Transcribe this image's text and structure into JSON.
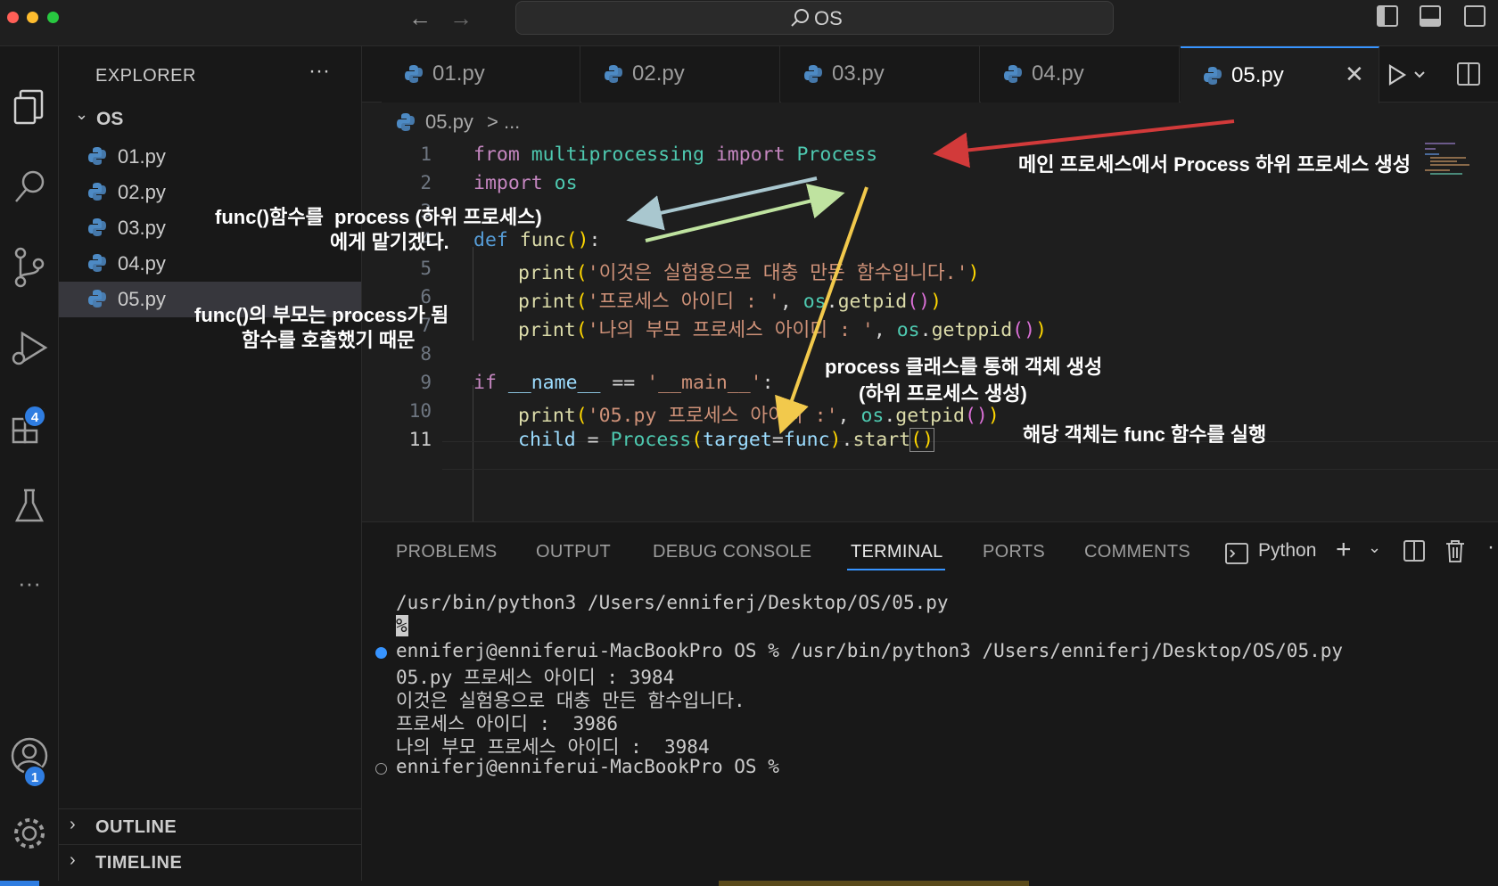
{
  "titlebar": {
    "search_text": "OS"
  },
  "activity": {
    "extensions_badge": "4",
    "accounts_badge": "1"
  },
  "sidebar": {
    "title": "EXPLORER",
    "more": "···",
    "folder": "OS",
    "files": [
      "01.py",
      "02.py",
      "03.py",
      "04.py",
      "05.py"
    ],
    "outline": "OUTLINE",
    "timeline": "TIMELINE"
  },
  "tabs": [
    "01.py",
    "02.py",
    "03.py",
    "04.py",
    "05.py"
  ],
  "breadcrumb": {
    "file": "05.py",
    "rest": "> ..."
  },
  "editor": {
    "line_numbers": [
      "1",
      "2",
      "3",
      "4",
      "5",
      "6",
      "7",
      "8",
      "9",
      "10",
      "11"
    ],
    "l1": {
      "from": "from",
      "module": "multiprocessing",
      "import": "import",
      "cls": "Process"
    },
    "l2": {
      "import": "import",
      "mod": "os"
    },
    "l4": {
      "def": "def",
      "name": "func",
      "open": "(",
      "close": ")",
      "colon": ":"
    },
    "l5": {
      "fn": "print",
      "open": "(",
      "str": "'이것은 실험용으로 대충 만든 함수입니다.'",
      "close": ")"
    },
    "l6": {
      "fn": "print",
      "open": "(",
      "str": "'프로세스 아이디 : '",
      "comma": ", ",
      "obj": "os",
      "dot": ".",
      "call": "getpid",
      "p": "()",
      "close": ")"
    },
    "l7": {
      "fn": "print",
      "open": "(",
      "str": "'나의 부모 프로세스 아이디 : '",
      "comma": ", ",
      "obj": "os",
      "dot": ".",
      "call": "getppid",
      "p": "()",
      "close": ")"
    },
    "l9": {
      "if": "if",
      "name": "__name__",
      "eq": " == ",
      "str": "'__main__'",
      "colon": ":"
    },
    "l10": {
      "fn": "print",
      "open": "(",
      "str": "'05.py 프로세스 아이디 :'",
      "comma": ", ",
      "obj": "os",
      "dot": ".",
      "call": "getpid",
      "p": "()",
      "close": ")"
    },
    "l11": {
      "var": "child",
      "eq": " = ",
      "cls": "Process",
      "open": "(",
      "kw": "target",
      "assign": "=",
      "arg": "func",
      "close": ")",
      "dot": ".",
      "call": "start",
      "p": "()"
    }
  },
  "panel": {
    "tabs": [
      "PROBLEMS",
      "OUTPUT",
      "DEBUG CONSOLE",
      "TERMINAL",
      "PORTS",
      "COMMENTS"
    ],
    "shell": "Python",
    "terminal": [
      "/usr/bin/python3 /Users/enniferj/Desktop/OS/05.py",
      "%",
      "enniferj@enniferui-MacBookPro OS % /usr/bin/python3 /Users/enniferj/Desktop/OS/05.py",
      "05.py 프로세스 아이디 : 3984",
      "이것은 실험용으로 대충 만든 함수입니다.",
      "프로세스 아이디 :  3986",
      "나의 부모 프로세스 아이디 :  3984",
      "enniferj@enniferui-MacBookPro OS %"
    ]
  },
  "annotations": {
    "main_process": "메인 프로세스에서 Process 하위 프로세스 생성",
    "func_delegate_1": "func()함수를  process (하위 프로세스)",
    "func_delegate_2": "에게 맡기겠다.",
    "parent_1": "func()의 부모는 process가 됨",
    "parent_2": "함수를 호출했기 때문",
    "object_1": "process 클래스를 통해 객체 생성",
    "object_2": "(하위 프로세스 생성)",
    "run_func": "해당 객체는 func 함수를 실행"
  },
  "colors": {
    "accent": "#3794ff",
    "arrow_red": "#d23a3a",
    "arrow_blue": "#a9c7cf",
    "arrow_green": "#bfe3a0",
    "arrow_yellow": "#f2c94c"
  }
}
